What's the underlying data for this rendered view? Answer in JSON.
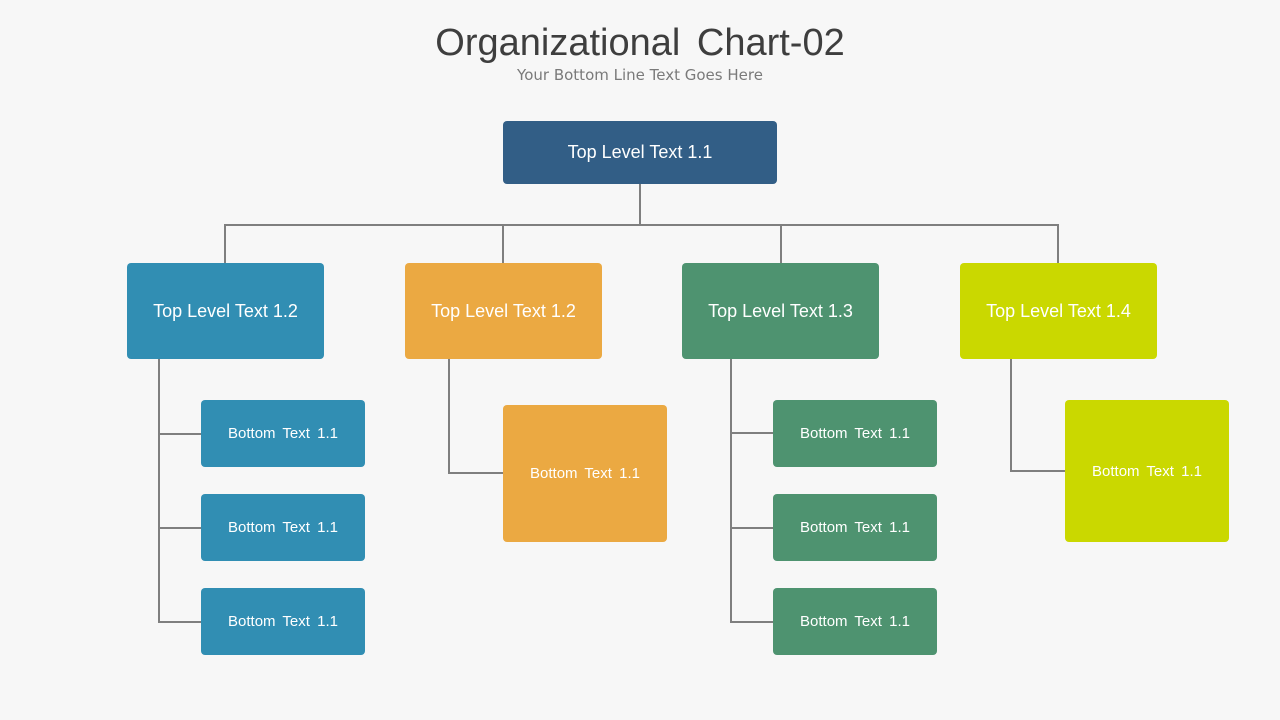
{
  "header": {
    "title": "Organizational  Chart-02",
    "subtitle": "Your Bottom Line Text Goes Here"
  },
  "root": {
    "label": "Top Level Text 1.1",
    "color": "#325e86"
  },
  "branches": [
    {
      "label": "Top Level Text 1.2",
      "color": "#318eb3",
      "children": [
        "Bottom Text  1.1",
        "Bottom Text  1.1",
        "Bottom Text  1.1"
      ]
    },
    {
      "label": "Top Level Text 1.2",
      "color": "#eba942",
      "children": [
        "Bottom Text  1.1"
      ]
    },
    {
      "label": "Top Level Text 1.3",
      "color": "#4e9370",
      "children": [
        "Bottom Text  1.1",
        "Bottom Text  1.1",
        "Bottom Text  1.1"
      ]
    },
    {
      "label": "Top Level Text 1.4",
      "color": "#cad800",
      "children": [
        "Bottom Text  1.1"
      ]
    }
  ],
  "connector_color": "#7f7f7f"
}
